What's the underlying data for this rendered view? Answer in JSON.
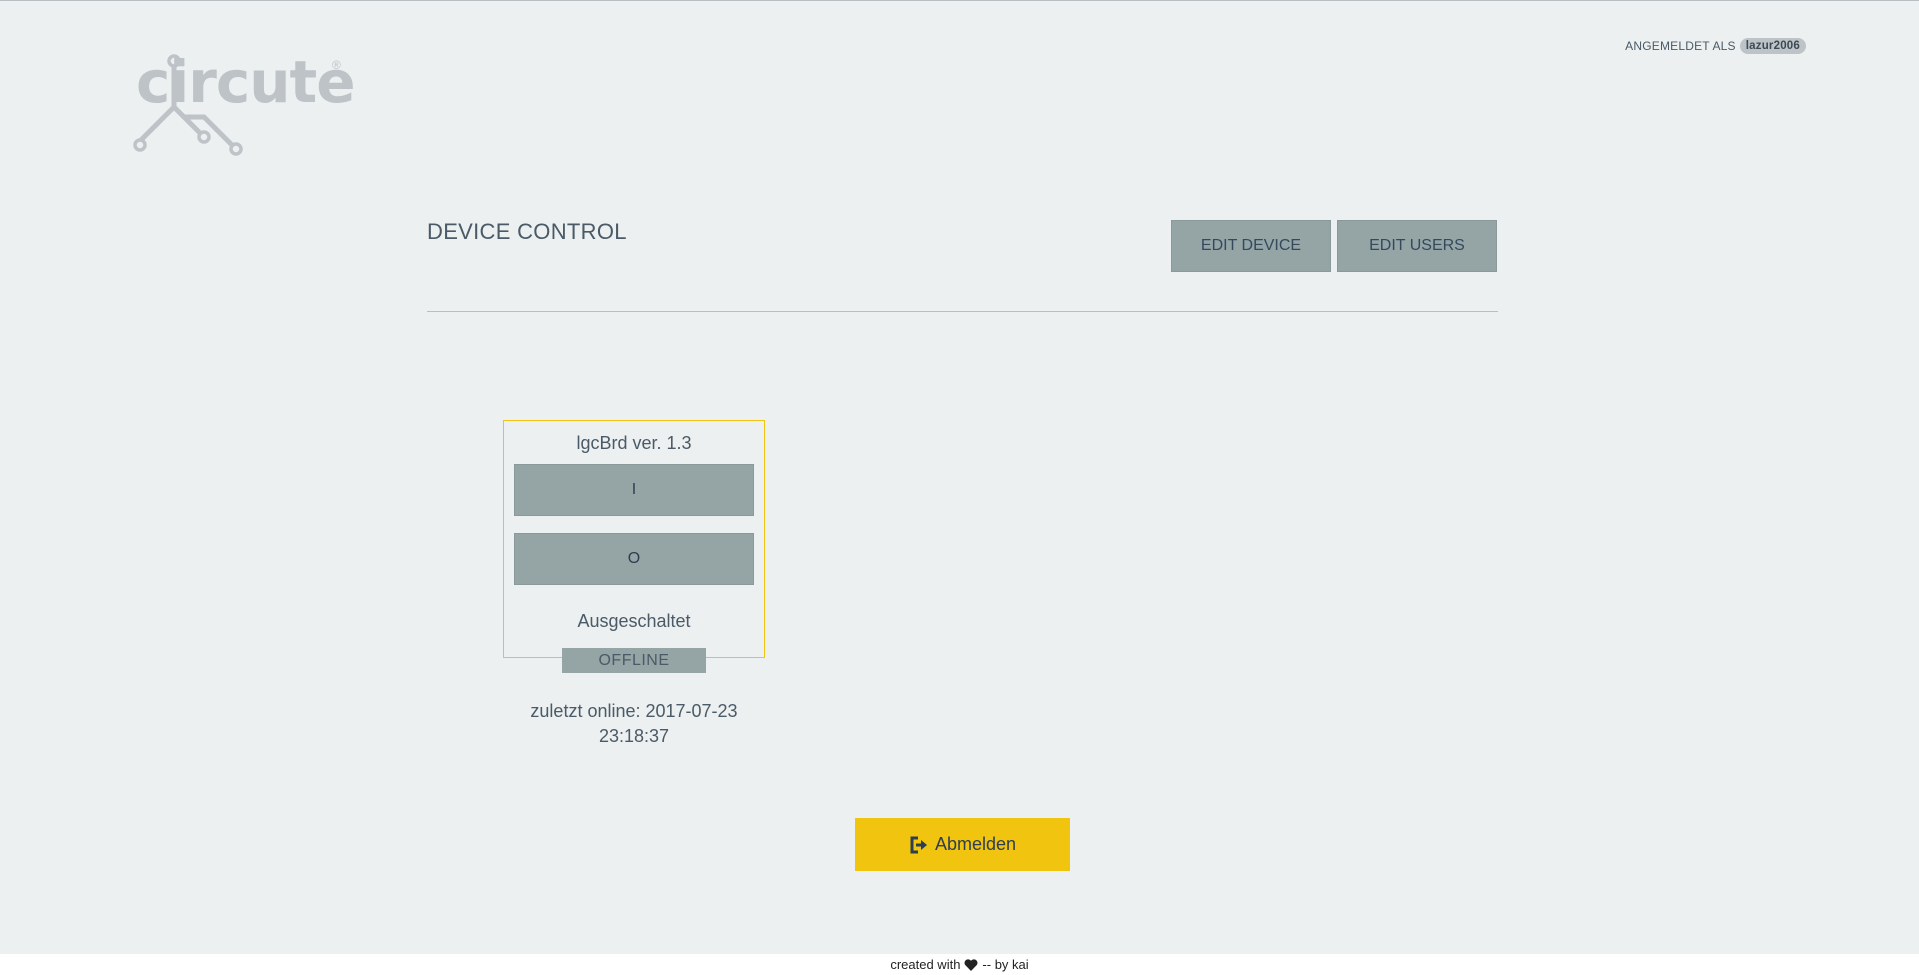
{
  "brand": {
    "logo_text": "circute",
    "logo_mark": "®"
  },
  "session": {
    "logged_in_label": "ANGEMELDET ALS",
    "username": "lazur2006"
  },
  "header": {
    "title": "DEVICE CONTROL",
    "edit_device_label": "EDIT DEVICE",
    "edit_users_label": "EDIT USERS"
  },
  "device": {
    "name": "lgcBrd ver. 1.3",
    "on_label": "I",
    "off_label": "O",
    "state": "Ausgeschaltet",
    "connection_status": "OFFLINE",
    "last_online_prefix": "zuletzt online: 2017-07-23",
    "last_online_time": "23:18:37"
  },
  "logout": {
    "label": "Abmelden",
    "icon": "sign-out-icon"
  },
  "footer": {
    "prefix": "created with",
    "icon": "heart-icon",
    "suffix": "-- by kai"
  },
  "colors": {
    "background": "#ecf0f1",
    "accent": "#f1c40f",
    "button": "#95a5a6",
    "text": "#4a5a66"
  }
}
